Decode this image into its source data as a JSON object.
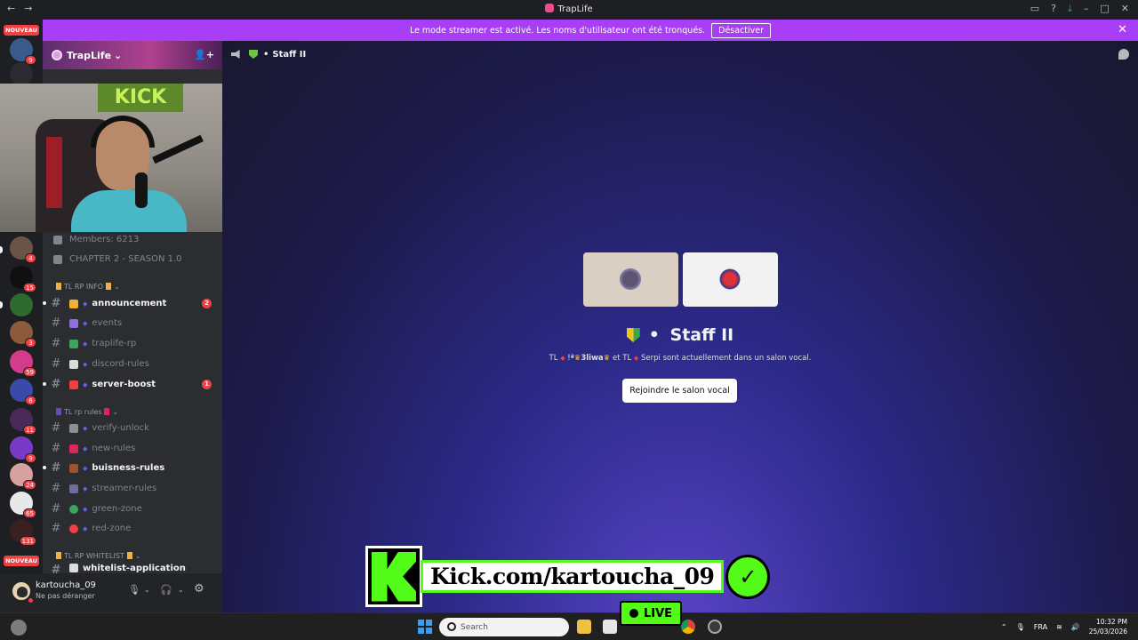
{
  "window": {
    "title": "TrapLife",
    "back_glyph": "←",
    "forward_glyph": "→"
  },
  "streamer_banner": {
    "message": "Le mode streamer est activé. Les noms d'utilisateur ont été tronqués.",
    "button_label": "Désactiver",
    "close_glyph": "✕"
  },
  "guild_rail": {
    "new_label_top": "NOUVEAU",
    "new_label_bottom": "NOUVEAU",
    "badges": [
      "9",
      "4",
      "15",
      "3",
      "59",
      "6",
      "11",
      "9",
      "24",
      "65",
      "131"
    ]
  },
  "server": {
    "name": "TrapLife",
    "chevron": "⌄",
    "invite_glyph": "👤+"
  },
  "channels": {
    "locked": [
      {
        "label": "Members: 6213"
      },
      {
        "label": "CHAPTER 2 - SEASON 1.0"
      }
    ],
    "category_info": "TL RP INFO",
    "info_channels": [
      {
        "label": "announcement",
        "unread": true,
        "count": "2",
        "emoji_color": "#f0b232"
      },
      {
        "label": "events",
        "unread": false,
        "count": "",
        "emoji_color": "#8e6fe0"
      },
      {
        "label": "traplife-rp",
        "unread": false,
        "count": "",
        "emoji_color": "#3ba55c"
      },
      {
        "label": "discord-rules",
        "unread": false,
        "count": "",
        "emoji_color": "#dcdcdc"
      },
      {
        "label": "server-boost",
        "unread": true,
        "count": "1",
        "emoji_color": "#f23f43"
      }
    ],
    "category_rules": "TL rp rules",
    "rules_channels": [
      {
        "label": "verify-unlock",
        "unread": false,
        "count": "",
        "emoji_color": "#8a8f98"
      },
      {
        "label": "new-rules",
        "unread": false,
        "count": "",
        "emoji_color": "#e0245e"
      },
      {
        "label": "buisness-rules",
        "unread": true,
        "count": "",
        "emoji_color": "#a0522d"
      },
      {
        "label": "streamer-rules",
        "unread": false,
        "count": "",
        "emoji_color": "#6e6e9e"
      },
      {
        "label": "green-zone",
        "unread": false,
        "count": "",
        "emoji_color": "#3ba55c"
      },
      {
        "label": "red-zone",
        "unread": false,
        "count": "",
        "emoji_color": "#f23f43"
      }
    ],
    "category_whitelist": "TL RP WHITELIST",
    "partial_channel": "whitelist-application"
  },
  "user": {
    "name": "kartoucha_09",
    "status": "Ne pas déranger",
    "mic_glyph": "🎙",
    "headset_glyph": "🎧",
    "settings_glyph": "⚙"
  },
  "voice_channel": {
    "header_name": "Staff II",
    "title": "Staff II",
    "separator": "•",
    "sub_prefix": "TL",
    "sub_user_a": "3liwa",
    "sub_mid": "et TL",
    "sub_user_b": "Serpi",
    "sub_suffix": "sont actuellement dans un salon vocal.",
    "join_label": "Rejoindre le salon vocal"
  },
  "overlay": {
    "kick_url": "Kick.com/kartoucha_09",
    "live_label": "LIVE",
    "check_glyph": "✓"
  },
  "taskbar": {
    "search_placeholder": "Search",
    "lang": "FRA",
    "time": "10:32 PM",
    "date": "25/03/2026"
  },
  "colors": {
    "accent_purple": "#a83ef5",
    "kick_green": "#53fc18",
    "discord_red": "#f23f43",
    "blurple": "#5865f2"
  }
}
